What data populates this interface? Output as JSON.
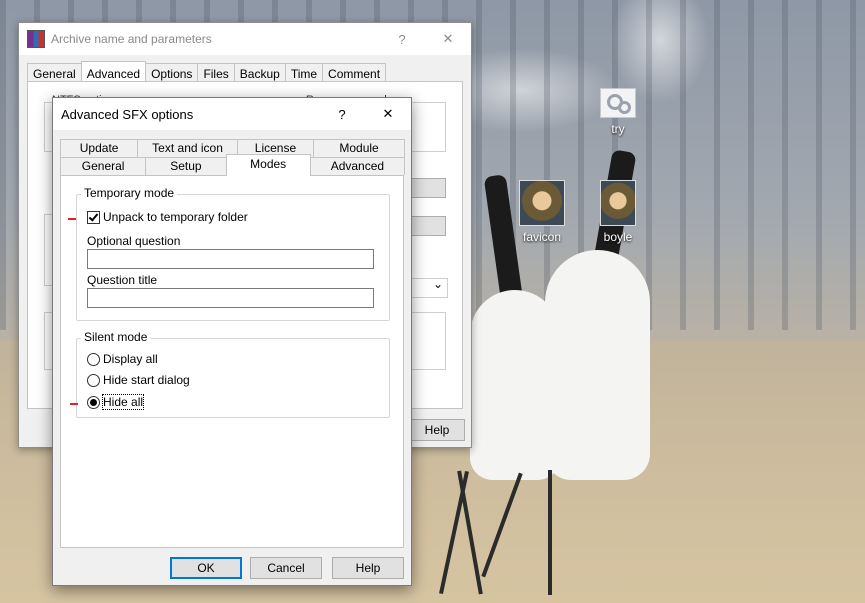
{
  "desktop": {
    "icons": [
      {
        "label": "try",
        "icon": "gear-file-icon"
      },
      {
        "label": "favicon",
        "icon": "avatar-image-icon"
      },
      {
        "label": "boyle",
        "icon": "avatar-image-icon"
      }
    ]
  },
  "back_window": {
    "title": "Archive name and parameters",
    "help_glyph": "?",
    "close_glyph": "✕",
    "tabs": [
      "General",
      "Advanced",
      "Options",
      "Files",
      "Backup",
      "Time",
      "Comment"
    ],
    "active_tab": "Advanced",
    "partial_label_left": "NTFS options",
    "partial_label_right": "Recovery record",
    "help_button": "Help",
    "dropdown_glyph": "⌄"
  },
  "dialog": {
    "title": "Advanced SFX options",
    "help_glyph": "?",
    "close_glyph": "✕",
    "tabs_row1": [
      "Update",
      "Text and icon",
      "License",
      "Module"
    ],
    "tabs_row2": [
      "General",
      "Setup",
      "Modes",
      "Advanced"
    ],
    "active_tab": "Modes",
    "temporary_mode": {
      "group_label": "Temporary mode",
      "unpack_label": "Unpack to temporary folder",
      "unpack_checked": true,
      "optional_question_label": "Optional question",
      "optional_question_value": "",
      "question_title_label": "Question title",
      "question_title_value": ""
    },
    "silent_mode": {
      "group_label": "Silent mode",
      "options": [
        "Display all",
        "Hide start dialog",
        "Hide all"
      ],
      "selected": "Hide all"
    },
    "buttons": {
      "ok": "OK",
      "cancel": "Cancel",
      "help": "Help"
    },
    "annotation_color": "#e02222"
  }
}
